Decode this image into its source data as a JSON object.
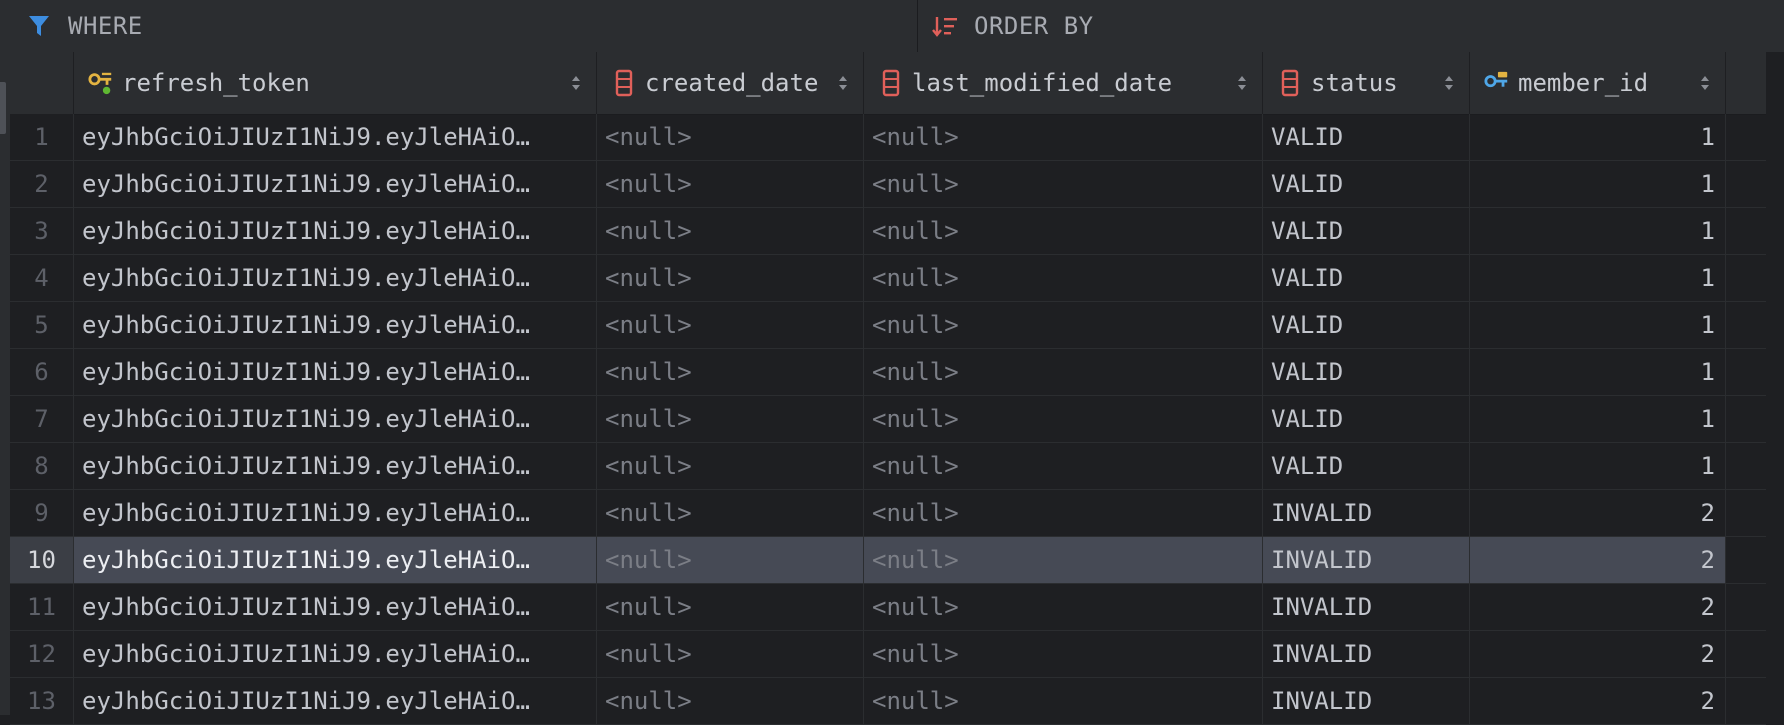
{
  "filters": {
    "where_label": "WHERE",
    "order_label": "ORDER BY"
  },
  "columns": [
    {
      "key": "refresh_token",
      "title": "refresh_token",
      "icon": "primary-key-icon"
    },
    {
      "key": "created_date",
      "title": "created_date",
      "icon": "column-icon"
    },
    {
      "key": "last_modified_date",
      "title": "last_modified_date",
      "icon": "column-icon"
    },
    {
      "key": "status",
      "title": "status",
      "icon": "column-icon"
    },
    {
      "key": "member_id",
      "title": "member_id",
      "icon": "foreign-key-icon"
    }
  ],
  "rows": [
    {
      "n": "1",
      "refresh_token": "eyJhbGciOiJIUzI1NiJ9.eyJleHAiO…",
      "created_date": "<null>",
      "last_modified_date": "<null>",
      "status": "VALID",
      "member_id": "1"
    },
    {
      "n": "2",
      "refresh_token": "eyJhbGciOiJIUzI1NiJ9.eyJleHAiO…",
      "created_date": "<null>",
      "last_modified_date": "<null>",
      "status": "VALID",
      "member_id": "1"
    },
    {
      "n": "3",
      "refresh_token": "eyJhbGciOiJIUzI1NiJ9.eyJleHAiO…",
      "created_date": "<null>",
      "last_modified_date": "<null>",
      "status": "VALID",
      "member_id": "1"
    },
    {
      "n": "4",
      "refresh_token": "eyJhbGciOiJIUzI1NiJ9.eyJleHAiO…",
      "created_date": "<null>",
      "last_modified_date": "<null>",
      "status": "VALID",
      "member_id": "1"
    },
    {
      "n": "5",
      "refresh_token": "eyJhbGciOiJIUzI1NiJ9.eyJleHAiO…",
      "created_date": "<null>",
      "last_modified_date": "<null>",
      "status": "VALID",
      "member_id": "1"
    },
    {
      "n": "6",
      "refresh_token": "eyJhbGciOiJIUzI1NiJ9.eyJleHAiO…",
      "created_date": "<null>",
      "last_modified_date": "<null>",
      "status": "VALID",
      "member_id": "1"
    },
    {
      "n": "7",
      "refresh_token": "eyJhbGciOiJIUzI1NiJ9.eyJleHAiO…",
      "created_date": "<null>",
      "last_modified_date": "<null>",
      "status": "VALID",
      "member_id": "1"
    },
    {
      "n": "8",
      "refresh_token": "eyJhbGciOiJIUzI1NiJ9.eyJleHAiO…",
      "created_date": "<null>",
      "last_modified_date": "<null>",
      "status": "VALID",
      "member_id": "1"
    },
    {
      "n": "9",
      "refresh_token": "eyJhbGciOiJIUzI1NiJ9.eyJleHAiO…",
      "created_date": "<null>",
      "last_modified_date": "<null>",
      "status": "INVALID",
      "member_id": "2"
    },
    {
      "n": "10",
      "refresh_token": "eyJhbGciOiJIUzI1NiJ9.eyJleHAiO…",
      "created_date": "<null>",
      "last_modified_date": "<null>",
      "status": "INVALID",
      "member_id": "2",
      "selected": true
    },
    {
      "n": "11",
      "refresh_token": "eyJhbGciOiJIUzI1NiJ9.eyJleHAiO…",
      "created_date": "<null>",
      "last_modified_date": "<null>",
      "status": "INVALID",
      "member_id": "2"
    },
    {
      "n": "12",
      "refresh_token": "eyJhbGciOiJIUzI1NiJ9.eyJleHAiO…",
      "created_date": "<null>",
      "last_modified_date": "<null>",
      "status": "INVALID",
      "member_id": "2"
    },
    {
      "n": "13",
      "refresh_token": "eyJhbGciOiJIUzI1NiJ9.eyJleHAiO…",
      "created_date": "<null>",
      "last_modified_date": "<null>",
      "status": "INVALID",
      "member_id": "2"
    }
  ],
  "colors": {
    "filter_icon": "#3d8de0",
    "order_icon": "#e0605a",
    "key_icon": "#e3b341",
    "fk_icon": "#4fa7e8",
    "column_icon": "#e0605a",
    "selected_row": "#464a55"
  }
}
